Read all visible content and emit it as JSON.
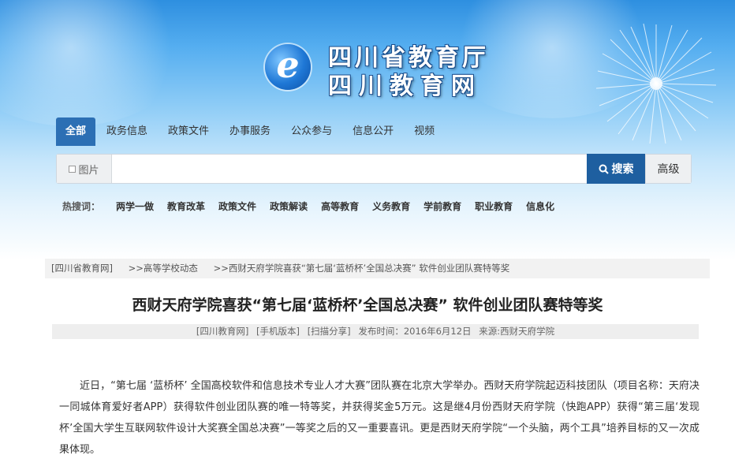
{
  "header": {
    "logo_line1": "四川省教育厅",
    "logo_line2": "四川教育网",
    "logo_letter": "e"
  },
  "nav": {
    "tabs": [
      {
        "label": "全部",
        "active": true
      },
      {
        "label": "政务信息"
      },
      {
        "label": "政策文件"
      },
      {
        "label": "办事服务"
      },
      {
        "label": "公众参与"
      },
      {
        "label": "信息公开"
      },
      {
        "label": "视频"
      }
    ]
  },
  "search": {
    "image_option": "图片",
    "value": "",
    "button": "搜索",
    "advanced": "高级"
  },
  "hot": {
    "label": "热搜词：",
    "items": [
      "两学一做",
      "教育改革",
      "政策文件",
      "政策解读",
      "高等教育",
      "义务教育",
      "学前教育",
      "职业教育",
      "信息化"
    ]
  },
  "breadcrumb": {
    "items": [
      "[四川省教育网]",
      ">>高等学校动态",
      ">>西财天府学院喜获“第七届‘蓝桥杯’全国总决赛” 软件创业团队赛特等奖"
    ]
  },
  "article": {
    "title": "西财天府学院喜获“第七届‘蓝桥杯’全国总决赛” 软件创业团队赛特等奖",
    "meta": {
      "source_site": "[四川教育网]",
      "mobile": "[手机版本]",
      "share": "[扫描分享]",
      "published": "发布时间：2016年6月12日",
      "source": "来源:西财天府学院"
    },
    "body": "近日，“第七届 ‘蓝桥杯’ 全国高校软件和信息技术专业人才大赛”团队赛在北京大学举办。西财天府学院起迈科技团队（项目名称：天府决一同城体育爱好者APP）获得软件创业团队赛的唯一特等奖，并获得奖金5万元。这是继4月份西财天府学院（快跑APP）获得“第三届‘发现杯’全国大学生互联网软件设计大奖赛全国总决赛”一等奖之后的又一重要喜讯。更是西财天府学院“一个头脑，两个工具”培养目标的又一次成果体现。"
  },
  "colors": {
    "tab_active": "#2c6fb4",
    "search_button": "#1e5fa0",
    "header_top": "#2e8fe0"
  }
}
